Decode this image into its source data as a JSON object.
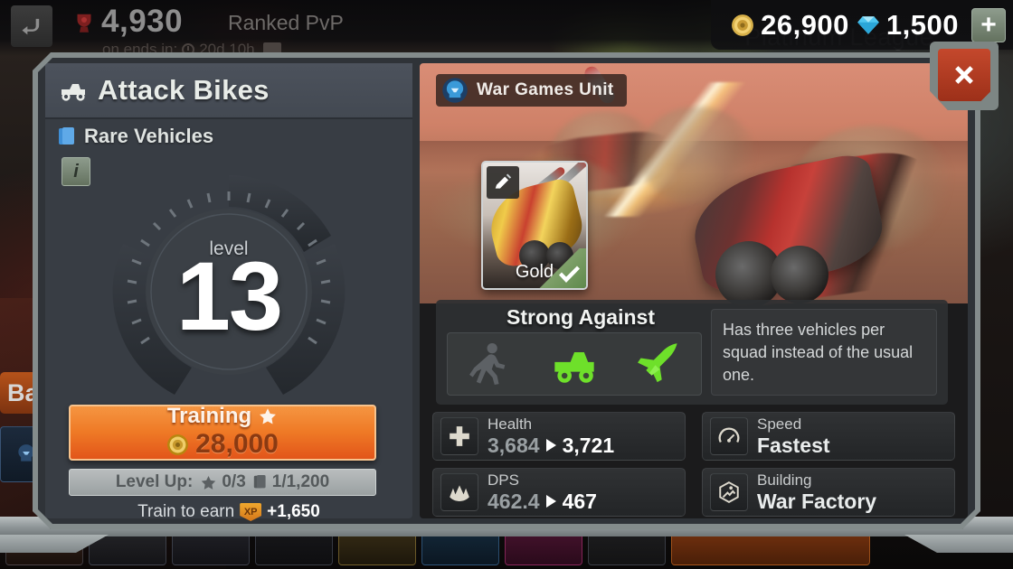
{
  "hud": {
    "back_icon": "back-arrow-icon",
    "trophy_icon": "trophy-icon",
    "score": "4,930",
    "mode": "Ranked PvP",
    "season_text": "on ends in:",
    "season_time": "20d 10h",
    "league": "Platinum League",
    "gold_icon": "gold-coin-icon",
    "gold": "26,900",
    "gem_icon": "diamond-icon",
    "gems": "1,500",
    "add_label": "+",
    "battle_label": "Ba"
  },
  "dialog": {
    "title": "Attack Bikes",
    "title_icon": "vehicle-icon",
    "rarity": "Rare Vehicles",
    "rarity_icon": "rarity-card-icon",
    "info_label": "i",
    "close_icon": "close-x-icon"
  },
  "gauge": {
    "level_label": "level",
    "level_value": "13",
    "stars": "0/3",
    "star_icon": "star-icon"
  },
  "training": {
    "label": "Training",
    "star_icon": "star-icon",
    "coin_icon": "gold-coin-icon",
    "cost": "28,000",
    "levelup_label": "Level Up:",
    "levelup_stars": "0/3",
    "levelup_cards": "1/1,200",
    "card_icon": "card-icon",
    "earn_prefix": "Train to earn",
    "xp_badge": "XP",
    "earn_amount": "+1,650"
  },
  "unit": {
    "badge_label": "War Games Unit",
    "badge_icon": "skull-helmet-icon",
    "skin_name": "Gold",
    "skin_edit_icon": "pencil-icon",
    "skin_selected_icon": "checkmark-icon"
  },
  "strong_against": {
    "title": "Strong Against",
    "targets": [
      {
        "name": "infantry-icon",
        "active": false
      },
      {
        "name": "vehicle-icon",
        "active": true
      },
      {
        "name": "aircraft-icon",
        "active": true
      }
    ],
    "description": "Has three vehicles per squad instead of the usual one."
  },
  "stats": [
    {
      "label": "Health",
      "icon": "health-cross-icon",
      "current": "3,684",
      "next": "3,721",
      "upgrade": true
    },
    {
      "label": "Speed",
      "icon": "speedometer-icon",
      "value": "Fastest",
      "upgrade": false
    },
    {
      "label": "DPS",
      "icon": "dps-claw-icon",
      "current": "462.4",
      "next": "467",
      "upgrade": true
    },
    {
      "label": "Building",
      "icon": "war-factory-icon",
      "value": "War Factory",
      "upgrade": false
    }
  ],
  "colors": {
    "accent_orange": "#ef7a26",
    "panel_bg": "#2f3338",
    "frame": "#848c8c",
    "active_green": "#6ee02a",
    "close_red": "#c4482c"
  }
}
